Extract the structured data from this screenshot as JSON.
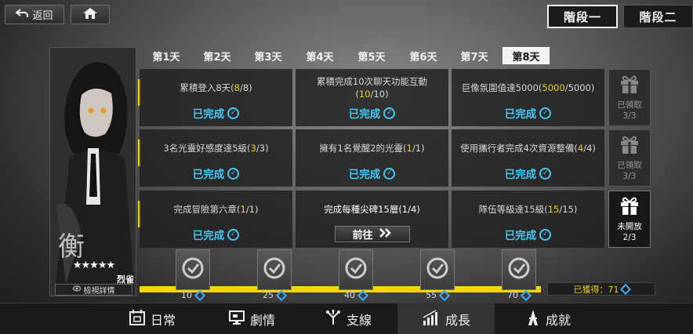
{
  "top": {
    "back_label": "返回"
  },
  "stages": [
    "階段一",
    "階段二"
  ],
  "character": {
    "stars": "★★★★★",
    "name": "烈雀",
    "detail_label": "檢視詳情"
  },
  "day_tabs": [
    "第1天",
    "第2天",
    "第3天",
    "第4天",
    "第5天",
    "第6天",
    "第7天",
    "第8天"
  ],
  "active_day_index": 7,
  "tasks": [
    [
      {
        "text": "累積登入8天(",
        "hl": "8",
        "tail": "/8)",
        "state": "已完成"
      },
      {
        "text": "累積完成10次聊天功能互動(",
        "hl": "10",
        "tail": "/10)",
        "state": "已完成"
      },
      {
        "text": "巨像氛圍值達5000(",
        "hl": "5000",
        "tail": "/5000)",
        "state": "已完成"
      }
    ],
    [
      {
        "text": "3名光靈好感度達5級(",
        "hl": "3",
        "tail": "/3)",
        "state": "已完成"
      },
      {
        "text": "擁有1名覺醒2的光靈(",
        "hl": "1",
        "tail": "/1)",
        "state": "已完成"
      },
      {
        "text": "使用攜行者完成4次資源整備(",
        "hl": "4",
        "tail": "/4)",
        "state": "已完成"
      }
    ],
    [
      {
        "text": "完成冒險第六章(",
        "hl": "1",
        "tail": "/1)",
        "state": "已完成"
      },
      {
        "text": "完成每種尖碑15層(1/4)",
        "hl": "",
        "tail": "",
        "state": "前往"
      },
      {
        "text": "隊伍等級達15級(",
        "hl": "15",
        "tail": "/15)",
        "state": "已完成"
      }
    ]
  ],
  "rewards": [
    {
      "status": "已領取",
      "count": "3/3"
    },
    {
      "status": "已領取",
      "count": "3/3"
    },
    {
      "status": "未開放",
      "count": "2/3"
    }
  ],
  "progress": {
    "milestones": [
      "10",
      "25",
      "40",
      "55",
      "70"
    ],
    "obtained_label": "已獲得：71",
    "fill_fraction": 1.0
  },
  "bottom_nav": [
    "日常",
    "劇情",
    "支線",
    "成長",
    "成就"
  ],
  "active_nav_index": 3,
  "colors": {
    "accent_cyan": "#45c9f5",
    "highlight_yellow": "#e6d21e",
    "progress_yellow": "#f2d600"
  }
}
